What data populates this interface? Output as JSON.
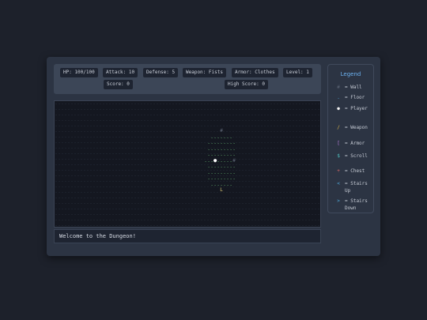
{
  "stats": {
    "hp": "HP: 100/100",
    "attack": "Attack: 10",
    "defense": "Defense: 5",
    "weapon": "Weapon: Fists",
    "armor": "Armor: Clothes",
    "level": "Level: 1",
    "score": "Score: 0",
    "high_score": "High Score: 0"
  },
  "message": "Welcome to the Dungeon!",
  "legend": {
    "title": "Legend",
    "items": [
      {
        "symbol": "#",
        "desc": "= Wall",
        "color": "#5d6676"
      },
      {
        "symbol": ".",
        "desc": "= Floor",
        "color": "#4fa7d8"
      },
      {
        "symbol": "●",
        "desc": "= Player",
        "color": "#f2f2f2"
      },
      {
        "symbol": "/",
        "desc": "= Weapon",
        "color": "#d9b44a"
      },
      {
        "symbol": "[",
        "desc": "= Armor",
        "color": "#b67ad9"
      },
      {
        "symbol": "$",
        "desc": "= Scroll",
        "color": "#4fc1c1"
      },
      {
        "symbol": "+",
        "desc": "= Chest",
        "color": "#d96a6a"
      },
      {
        "symbol": "<",
        "desc": "= Stairs Up",
        "color": "#4fa7d8"
      },
      {
        "symbol": ">",
        "desc": "= Stairs Down",
        "color": "#4fa7d8"
      }
    ]
  },
  "map": {
    "floor_color": "#6fc37a",
    "wall_color": "#5d6676",
    "player_color": "#ffffff",
    "stairs_color": "#e6d27a",
    "rows": [
      "      #      ",
      "   .......   ",
      "  .........  ",
      "  .........  ",
      "  .........  ",
      " ...●.....#  ",
      "  .........  ",
      "  .........  ",
      "  .........  ",
      "   .......   ",
      "      L      "
    ]
  }
}
